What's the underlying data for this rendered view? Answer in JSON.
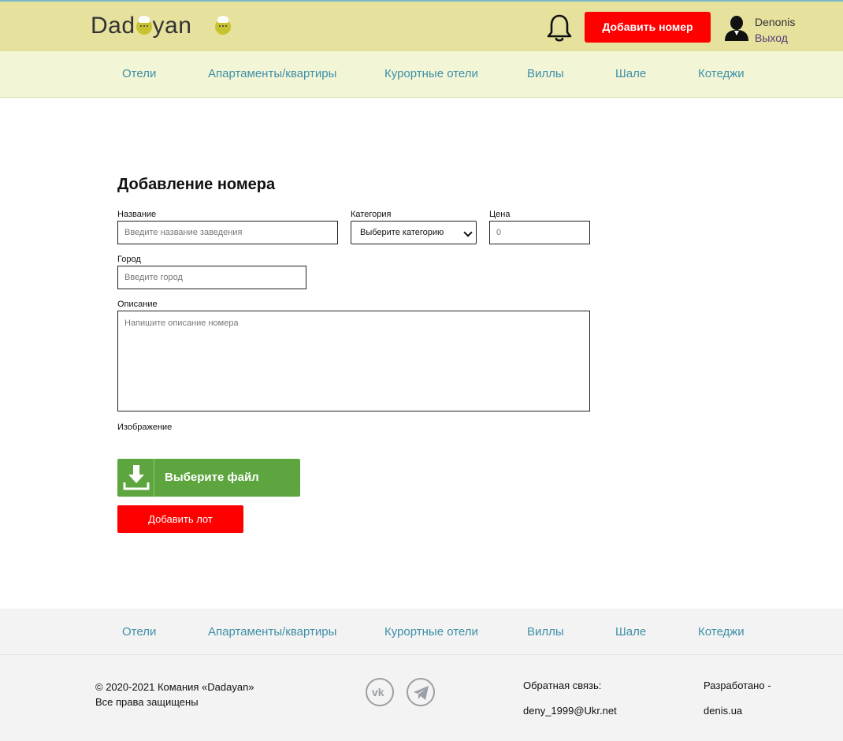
{
  "header": {
    "logo_text_1": "Dad",
    "logo_text_2": "yan",
    "add_room_label": "Добавить номер",
    "user_name": "Denonis",
    "logout_label": "Выход"
  },
  "nav": {
    "items": [
      "Отели",
      "Апартаменты/квартиры",
      "Курортные отели",
      "Виллы",
      "Шале",
      "Котеджи"
    ]
  },
  "form": {
    "title": "Добавление номера",
    "name_label": "Название",
    "name_placeholder": "Введите название заведения",
    "category_label": "Категория",
    "category_selected": "Выберите категорию",
    "price_label": "Цена",
    "price_placeholder": "0",
    "city_label": "Город",
    "city_placeholder": "Введите город",
    "description_label": "Описание",
    "description_placeholder": "Напишите описание номера",
    "image_label": "Изображение",
    "file_button_label": "Выберите файл",
    "submit_label": "Добавить лот"
  },
  "footer": {
    "nav_items": [
      "Отели",
      "Апартаменты/квартиры",
      "Курортные отели",
      "Виллы",
      "Шале",
      "Котеджи"
    ],
    "copyright_line1": "© 2020-2021 Комания «Dadayan»",
    "copyright_line2": "Все права защищены",
    "social": [
      "vk-icon",
      "telegram-icon"
    ],
    "feedback_label": "Обратная связь:",
    "feedback_email": "deny_1999@Ukr.net",
    "developed_label": "Разработано -",
    "developed_site": "denis.ua"
  },
  "colors": {
    "header_bg": "#e6e19d",
    "nav_bg": "#f2f6d6",
    "accent_red": "#ff0000",
    "file_button_green": "#5da53f",
    "link_blue": "#3f8fa8",
    "footer_bg": "#f3f3f3"
  }
}
